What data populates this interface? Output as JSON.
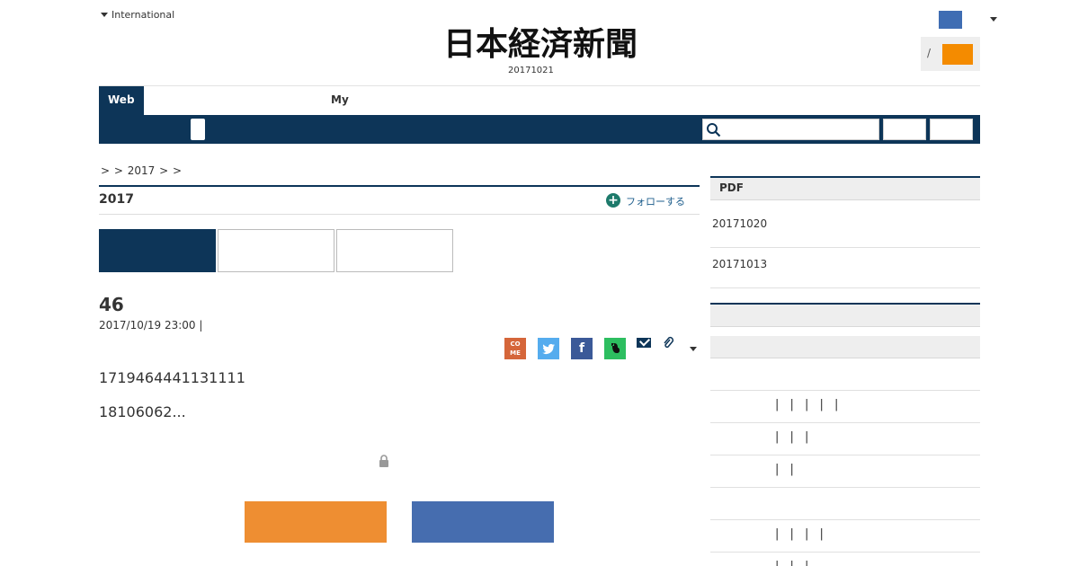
{
  "header": {
    "international_label": "International",
    "logo_text": "日本経済新聞",
    "date": "20171021",
    "login_separator": "/"
  },
  "nav": {
    "tab_web": "Web",
    "tab_my": "My"
  },
  "breadcrumb": ">  > 2017 >  >",
  "section": {
    "title": "2017",
    "follow_label": "フォローする",
    "follow_icon": "+"
  },
  "article": {
    "title": "46",
    "date": "2017/10/19 23:00 |",
    "body_line_1": "1719464441131111",
    "body_line_2": "18106062..."
  },
  "share": {
    "come": "CO ME",
    "facebook": "f"
  },
  "sidebar": {
    "pdf_title": "PDF",
    "pdf_items": [
      "20171020",
      "20171013"
    ],
    "ranking_rows": [
      "",
      "| | | | |",
      "| | |",
      "| |",
      "",
      "| | | |",
      "| | |"
    ]
  },
  "colors": {
    "navy": "#0d3558",
    "orange": "#ee8e32",
    "blue": "#466daf",
    "login_orange": "#f48b00"
  }
}
